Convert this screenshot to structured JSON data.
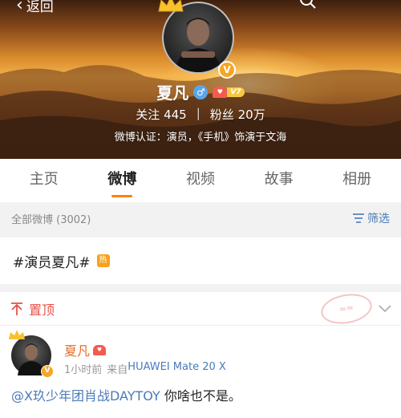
{
  "nav": {
    "back_label": "返回"
  },
  "profile": {
    "name": "夏凡",
    "gender_symbol": "♂",
    "vip_level": "V7",
    "following_label": "关注",
    "following_count": "445",
    "followers_label": "粉丝",
    "followers_count": "20万",
    "verification": "微博认证：演员，《手机》饰演于文海"
  },
  "tabs": [
    {
      "label": "主页",
      "active": false
    },
    {
      "label": "微博",
      "active": true
    },
    {
      "label": "视频",
      "active": false
    },
    {
      "label": "故事",
      "active": false
    },
    {
      "label": "相册",
      "active": false
    }
  ],
  "filter_bar": {
    "all_weibo": "全部微博 (3002)",
    "filter_label": "筛选"
  },
  "topic": {
    "text": "#演员夏凡#",
    "hot_badge": "热"
  },
  "pinned_card": {
    "pin_label": "置顶",
    "post": {
      "author": "夏凡",
      "time": "1小时前",
      "source_prefix": "来自",
      "device": "HUAWEI Mate 20 X",
      "mention": "@X玖少年团肖战DAYTOY",
      "text": " 你啥也不是。"
    }
  },
  "colors": {
    "accent_orange": "#ff8200",
    "link_blue": "#4a7ab8",
    "pin_red": "#e8504a"
  }
}
